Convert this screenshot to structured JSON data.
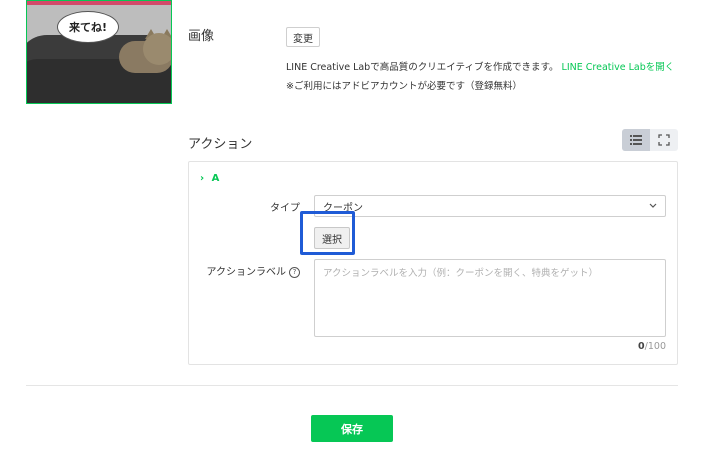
{
  "image_section": {
    "label": "画像",
    "change_button": "変更",
    "bubble_text": "来てね!",
    "creative_lab_text": "LINE Creative Labで高品質のクリエイティブを作成できます。",
    "creative_lab_link": "LINE Creative Labを開く",
    "note": "※ご利用にはアドビアカウントが必要です（登録無料）"
  },
  "action_section": {
    "title": "アクション",
    "view_toggle": {
      "active": "list",
      "icons": [
        "list-icon",
        "expand-icon"
      ]
    },
    "panel": {
      "header_chevron": "›",
      "header_label": "A",
      "type_label": "タイプ",
      "type_value": "クーポン",
      "select_button": "選択",
      "action_label_label": "アクションラベル",
      "help_glyph": "?",
      "action_label_placeholder": "アクションラベルを入力（例：クーポンを開く、特典をゲット）",
      "action_label_value": "",
      "counter_current": "0",
      "counter_max": "/100"
    }
  },
  "footer": {
    "save_button": "保存"
  },
  "colors": {
    "accent_green": "#06c755",
    "highlight_blue": "#1f5bd6",
    "border": "#cfcfcf"
  }
}
